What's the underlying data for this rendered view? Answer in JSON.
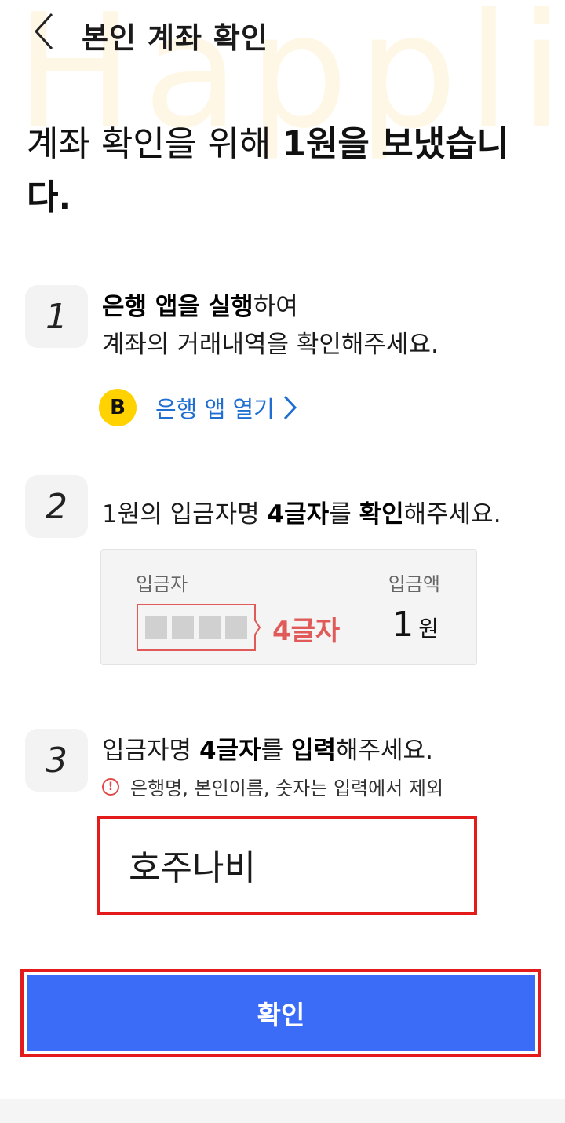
{
  "watermark": "Happli",
  "header": {
    "title": "본인 계좌 확인"
  },
  "headline": {
    "part1": "계좌 확인을 위해 ",
    "bold": "1원을 보냈습니다."
  },
  "steps": [
    {
      "number": "1",
      "bold1": "은행 앱을 실행",
      "text1": "하여",
      "line2": "계좌의 거래내역을 확인해주세요."
    },
    {
      "number": "2",
      "text1": "1원의 입금자명 ",
      "bold1": "4글자",
      "text2": "를 ",
      "bold2": "확인",
      "text3": "해주세요."
    },
    {
      "number": "3",
      "text1": "입금자명 ",
      "bold1": "4글자",
      "text2": "를 ",
      "bold2": "입력",
      "text3": "해주세요."
    }
  ],
  "bank_link": {
    "logo": "B",
    "label": "은행 앱 열기",
    "icon": "chevron-right-icon"
  },
  "deposit_example": {
    "depositor_label": "입금자",
    "amount_label": "입금액",
    "chars_note": "4글자",
    "amount_value": "1",
    "amount_unit": "원"
  },
  "warning": {
    "icon": "exclamation-circle-icon",
    "text": "은행명, 본인이름, 숫자는 입력에서 제외"
  },
  "input": {
    "value": "호주나비"
  },
  "confirm_button": {
    "label": "확인"
  },
  "colors": {
    "primary": "#3b6cf7",
    "highlight_border": "#e31b1b",
    "accent_red": "#e05a5a",
    "link_blue": "#1e6fd1",
    "bank_yellow": "#ffd200"
  }
}
